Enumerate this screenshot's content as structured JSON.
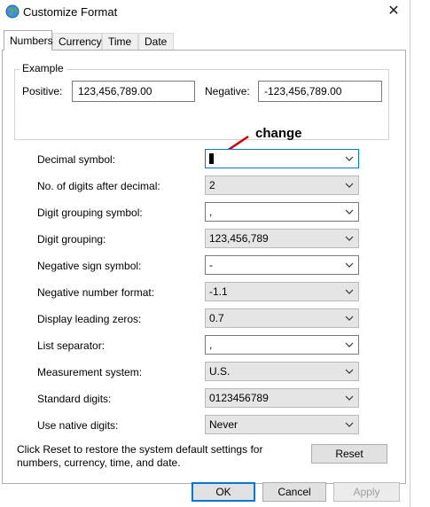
{
  "window": {
    "title": "Customize Format",
    "close_symbol": "✕"
  },
  "tabs": [
    {
      "label": "Numbers",
      "active": true
    },
    {
      "label": "Currency"
    },
    {
      "label": "Time"
    },
    {
      "label": "Date"
    }
  ],
  "example": {
    "legend": "Example",
    "positive_label": "Positive:",
    "positive_value": "123,456,789.00",
    "negative_label": "Negative:",
    "negative_value": "-123,456,789.00"
  },
  "annotation": {
    "text": "change",
    "color": "#d00000"
  },
  "settings": [
    {
      "label": "Decimal symbol:",
      "value": "",
      "editable": true,
      "focused": true
    },
    {
      "label": "No. of digits after decimal:",
      "value": "2",
      "editable": false
    },
    {
      "label": "Digit grouping symbol:",
      "value": ",",
      "editable": true
    },
    {
      "label": "Digit grouping:",
      "value": "123,456,789",
      "editable": false
    },
    {
      "label": "Negative sign symbol:",
      "value": "-",
      "editable": true
    },
    {
      "label": "Negative number format:",
      "value": "-1.1",
      "editable": false
    },
    {
      "label": "Display leading zeros:",
      "value": "0.7",
      "editable": false
    },
    {
      "label": "List separator:",
      "value": ",",
      "editable": true
    },
    {
      "label": "Measurement system:",
      "value": "U.S.",
      "editable": false
    },
    {
      "label": "Standard digits:",
      "value": "0123456789",
      "editable": false
    },
    {
      "label": "Use native digits:",
      "value": "Never",
      "editable": false
    }
  ],
  "reset": {
    "text": "Click Reset to restore the system default settings for numbers, currency, time, and date.",
    "button": "Reset"
  },
  "footer": {
    "ok": "OK",
    "cancel": "Cancel",
    "apply": "Apply"
  },
  "colors": {
    "accent": "#0078d7",
    "readonly_bg": "#e5e5e5"
  }
}
